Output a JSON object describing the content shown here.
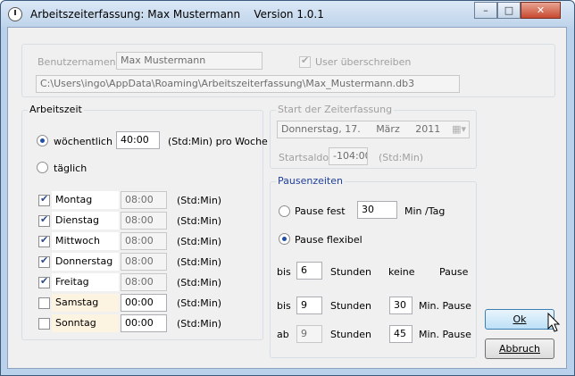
{
  "window": {
    "title": "Arbeitszeiterfassung: Max Mustermann    Version 1.0.1",
    "controls": {
      "minimize": "–",
      "maximize": "□",
      "close": "✕"
    }
  },
  "user": {
    "name_label": "Benutzernamen",
    "name_value": "Max Mustermann",
    "overwrite_label": "User überschreiben",
    "overwrite_checked": true,
    "path": "C:\\Users\\ingo\\AppData\\Roaming\\Arbeitszeiterfassung\\Max_Mustermann.db3"
  },
  "arbeitszeit": {
    "title": "Arbeitszeit",
    "weekly_label": "wöchentlich",
    "weekly_value": "40:00",
    "weekly_unit": "(Std:Min) pro Woche",
    "daily_label": "täglich",
    "days": [
      {
        "label": "Montag",
        "time": "08:00",
        "unit": "(Std:Min)",
        "checked": true
      },
      {
        "label": "Dienstag",
        "time": "08:00",
        "unit": "(Std:Min)",
        "checked": true
      },
      {
        "label": "Mittwoch",
        "time": "08:00",
        "unit": "(Std:Min)",
        "checked": true
      },
      {
        "label": "Donnerstag",
        "time": "08:00",
        "unit": "(Std:Min)",
        "checked": true
      },
      {
        "label": "Freitag",
        "time": "08:00",
        "unit": "(Std:Min)",
        "checked": true
      },
      {
        "label": "Samstag",
        "time": "00:00",
        "unit": "(Std:Min)",
        "checked": false
      },
      {
        "label": "Sonntag",
        "time": "00:00",
        "unit": "(Std:Min)",
        "checked": false
      }
    ]
  },
  "start": {
    "title": "Start der Zeiterfassung",
    "date_day": "Donnerstag, 17.",
    "date_month": "März",
    "date_year": "2011",
    "saldo_label": "Startsaldo",
    "saldo_value": "-104:00",
    "saldo_unit": "(Std:Min)"
  },
  "pausen": {
    "title": "Pausenzeiten",
    "fest_label": "Pause fest",
    "fest_value": "30",
    "fest_unit": "Min /Tag",
    "flexibel_label": "Pause flexibel",
    "rows": [
      {
        "prefix": "bis",
        "hours": "6",
        "stunden": "Stunden",
        "pause": "",
        "mid": "keine",
        "suffix": "Pause"
      },
      {
        "prefix": "bis",
        "hours": "9",
        "stunden": "Stunden",
        "pause": "30",
        "mid": "",
        "suffix": "Min. Pause"
      },
      {
        "prefix": "ab",
        "hours": "9",
        "stunden": "Stunden",
        "pause": "45",
        "mid": "",
        "suffix": "Min. Pause"
      }
    ]
  },
  "buttons": {
    "ok": "Ok",
    "cancel": "Abbruch"
  }
}
